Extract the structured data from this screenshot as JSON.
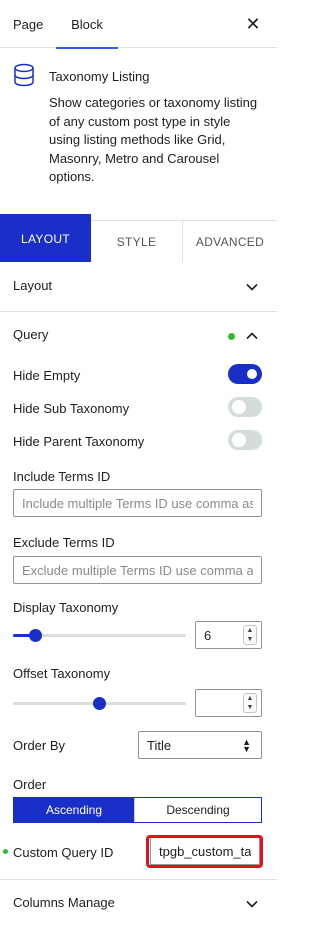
{
  "sidebar_tabs": {
    "page": "Page",
    "block": "Block"
  },
  "close_icon": "close-icon",
  "block": {
    "icon": "database-icon",
    "title": "Taxonomy Listing",
    "description": "Show categories or taxonomy listing of any custom post type in style using listing methods like Grid, Masonry, Metro and Carousel options."
  },
  "inspector_tabs": {
    "layout": "LAYOUT",
    "style": "STYLE",
    "advanced": "ADVANCED"
  },
  "panels": {
    "layout": "Layout",
    "query": "Query",
    "columns_manage": "Columns Manage"
  },
  "query": {
    "hide_empty": {
      "label": "Hide Empty",
      "on": true
    },
    "hide_sub_taxonomy": {
      "label": "Hide Sub Taxonomy",
      "on": false
    },
    "hide_parent_taxonomy": {
      "label": "Hide Parent Taxonomy",
      "on": false
    },
    "include_terms": {
      "label": "Include Terms ID",
      "placeholder": "Include multiple Terms ID use comma as separator"
    },
    "exclude_terms": {
      "label": "Exclude Terms ID",
      "placeholder": "Exclude multiple Terms ID use comma as separator"
    },
    "display_taxonomy": {
      "label": "Display Taxonomy",
      "value": "6"
    },
    "offset_taxonomy": {
      "label": "Offset Taxonomy",
      "value": ""
    },
    "order_by": {
      "label": "Order By",
      "value": "Title"
    },
    "order": {
      "label": "Order",
      "options": [
        "Ascending",
        "Descending"
      ],
      "selected": "Ascending"
    },
    "custom_query_id": {
      "label": "Custom Query ID",
      "value": "tpgb_custom_taxonomy"
    }
  },
  "colors": {
    "accent": "#1a2fc7",
    "wp_blue": "#3858e9",
    "status_dot": "#2ebd2e",
    "highlight": "#e3121a"
  }
}
